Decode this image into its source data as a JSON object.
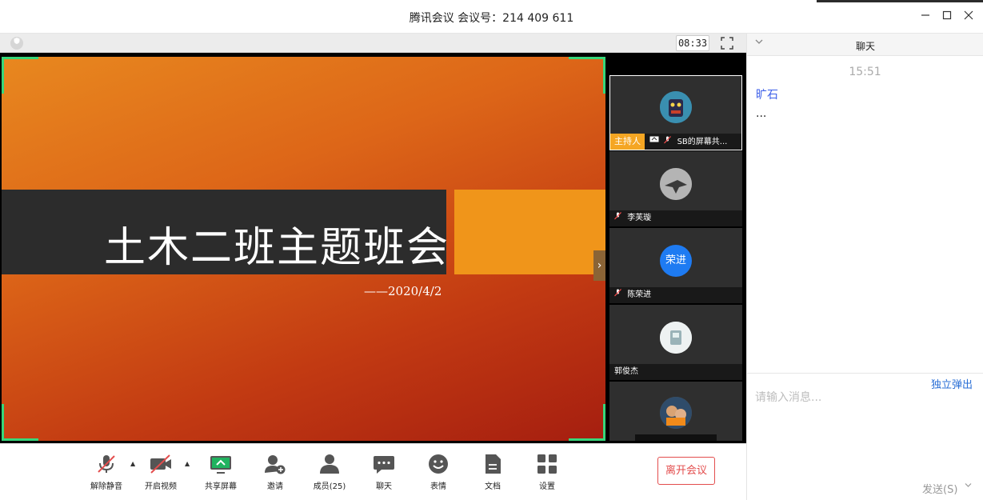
{
  "window": {
    "title": "腾讯会议  会议号：214 409 611"
  },
  "subbar": {
    "timer": "08:33"
  },
  "slide": {
    "title": "土木二班主题班会",
    "date": "——2020/4/2"
  },
  "participants": [
    {
      "name": "SB的屏幕共...",
      "host_label": "主持人",
      "avatar_color": "#2d6f8f"
    },
    {
      "name": "李芙璇",
      "avatar_color": "#8d8d8d"
    },
    {
      "name": "陈荣进",
      "avatar_text": "荣进",
      "avatar_color": "#1e7bf2"
    },
    {
      "name": "郭俊杰",
      "avatar_color": "#cfd8d8"
    },
    {
      "name": "",
      "avatar_color": "#6d5a47"
    }
  ],
  "toolbar": {
    "buttons": [
      {
        "label": "解除静音",
        "icon": "mic-muted-icon"
      },
      {
        "label": "开启视频",
        "icon": "camera-off-icon"
      },
      {
        "label": "共享屏幕",
        "icon": "share-screen-icon"
      },
      {
        "label": "邀请",
        "icon": "invite-icon"
      },
      {
        "label": "成员(25)",
        "icon": "members-icon"
      },
      {
        "label": "聊天",
        "icon": "chat-icon"
      },
      {
        "label": "表情",
        "icon": "emoji-icon"
      },
      {
        "label": "文档",
        "icon": "document-icon"
      },
      {
        "label": "设置",
        "icon": "settings-icon"
      }
    ],
    "leave_label": "离开会议"
  },
  "chat": {
    "title": "聊天",
    "time": "15:51",
    "sender": "旷石",
    "message": "...",
    "popout_label": "独立弹出",
    "input_placeholder": "请输入消息...",
    "send_label": "发送(S)"
  },
  "colors": {
    "accent": "#2a6fd6",
    "leave": "#e34d4d",
    "host": "#f5a623",
    "frame": "#37d67a"
  }
}
